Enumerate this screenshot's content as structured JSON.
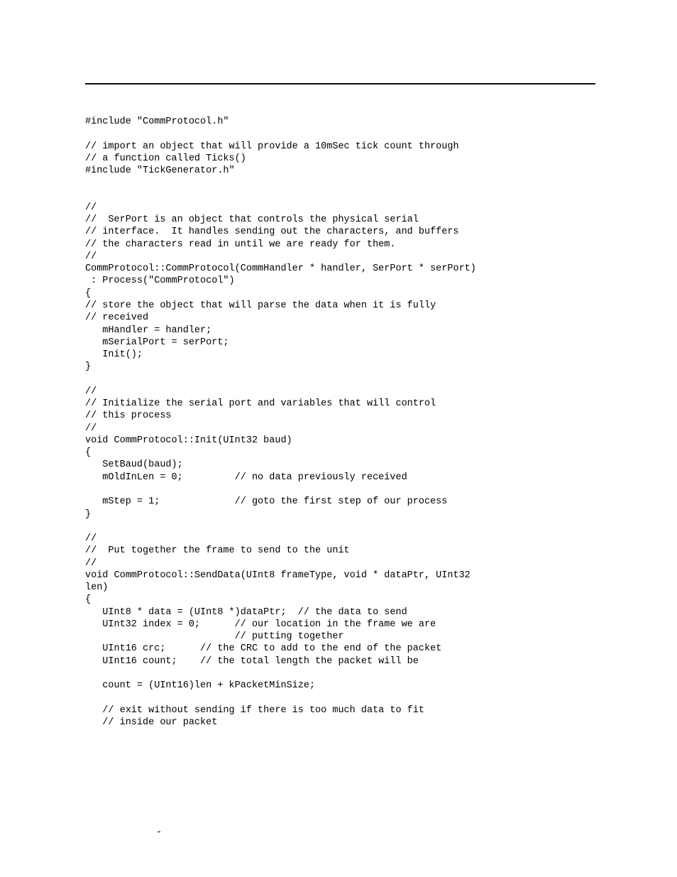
{
  "code": {
    "l01": "#include \"CommProtocol.h\"",
    "l02": "",
    "l03": "// import an object that will provide a 10mSec tick count through",
    "l04": "// a function called Ticks()",
    "l05": "#include \"TickGenerator.h\"",
    "l06": "",
    "l07": "",
    "l08": "//",
    "l09": "//  SerPort is an object that controls the physical serial",
    "l10": "// interface.  It handles sending out the characters, and buffers",
    "l11": "// the characters read in until we are ready for them.",
    "l12": "//",
    "l13": "CommProtocol::CommProtocol(CommHandler * handler, SerPort * serPort)",
    "l14": " : Process(\"CommProtocol\")",
    "l15": "{",
    "l16": "// store the object that will parse the data when it is fully",
    "l17": "// received",
    "l18": "   mHandler = handler;",
    "l19": "   mSerialPort = serPort;",
    "l20": "   Init();",
    "l21": "}",
    "l22": "",
    "l23": "//",
    "l24": "// Initialize the serial port and variables that will control",
    "l25": "// this process",
    "l26": "//",
    "l27": "void CommProtocol::Init(UInt32 baud)",
    "l28": "{",
    "l29": "   SetBaud(baud);",
    "l30": "   mOldInLen = 0;         // no data previously received",
    "l31": "",
    "l32": "   mStep = 1;             // goto the first step of our process",
    "l33": "}",
    "l34": "",
    "l35": "//",
    "l36": "//  Put together the frame to send to the unit",
    "l37": "//",
    "l38": "void CommProtocol::SendData(UInt8 frameType, void * dataPtr, UInt32",
    "l39": "len)",
    "l40": "{",
    "l41": "   UInt8 * data = (UInt8 *)dataPtr;  // the data to send",
    "l42": "   UInt32 index = 0;      // our location in the frame we are",
    "l43": "                          // putting together",
    "l44": "   UInt16 crc;      // the CRC to add to the end of the packet",
    "l45": "   UInt16 count;    // the total length the packet will be",
    "l46": "",
    "l47": "   count = (UInt16)len + kPacketMinSize;",
    "l48": "",
    "l49": "   // exit without sending if there is too much data to fit",
    "l50": "   // inside our packet"
  },
  "footer": "-"
}
